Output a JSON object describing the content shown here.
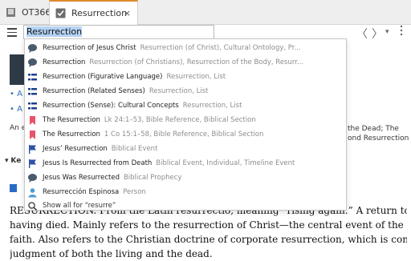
{
  "tabs": [
    {
      "label": "OT366",
      "icon": "book-icon"
    },
    {
      "label": "Resurrection",
      "icon": "checkbox-icon",
      "close": "×"
    }
  ],
  "toolbar": {
    "search_value": "Resurrection",
    "back": "〈",
    "forward": "〉",
    "more": "▾"
  },
  "article": {
    "bullets": [
      "A",
      "A"
    ],
    "summary_left": "An e",
    "summary_right_1": "the Dead; The",
    "summary_right_2": "ond Resurrection",
    "key_label": "Ke",
    "body_lines": [
      "RESURRECTION. From the Latin resurrectio, meaning “rising again.” A return to life after",
      "having died. Mainly refers to the resurrection of Christ—the central event of the Christian",
      "faith. Also refers to the Christian doctrine of corporate resurrection, which is connected to the",
      "judgment of both the living and the dead."
    ]
  },
  "suggestions": [
    {
      "icon": "speech-bubble-icon",
      "text": "Resurrection of Jesus Christ",
      "meta": "Resurrection (of Christ), Cultural Ontology, Pr..."
    },
    {
      "icon": "speech-bubble-icon",
      "text": "Resurrection",
      "meta": "Resurrection (of Christians), Resurrection of the Body, Resurr..."
    },
    {
      "icon": "list-icon",
      "text": "Resurrection (Figurative Language)",
      "meta": "Resurrection, List"
    },
    {
      "icon": "list-icon",
      "text": "Resurrection (Related Senses)",
      "meta": "Resurrection, List"
    },
    {
      "icon": "list-icon",
      "text": "Resurrection (Sense): Cultural Concepts",
      "meta": "Resurrection, List"
    },
    {
      "icon": "bookmark-icon",
      "text": "The Resurrection",
      "meta": "Lk 24:1–53, Bible Reference, Biblical Section"
    },
    {
      "icon": "bookmark-icon",
      "text": "The Resurrection",
      "meta": "1 Co 15:1–58, Bible Reference, Biblical Section"
    },
    {
      "icon": "flag-icon",
      "text": "Jesus’ Resurrection",
      "meta": "Biblical Event"
    },
    {
      "icon": "flag-icon",
      "text": "Jesus Is Resurrected from Death",
      "meta": "Biblical Event, Individual, Timeline Event"
    },
    {
      "icon": "speech-bubble-icon",
      "text": "Jesus Was Resurrected",
      "meta": "Biblical Prophecy"
    },
    {
      "icon": "person-icon",
      "text": "Resurrección Espinosa",
      "meta": "Person"
    },
    {
      "icon": "search-icon",
      "text": "Show all for “resurre”",
      "meta": ""
    }
  ],
  "colors": {
    "accent_tab": "#e0892d",
    "bubble": "#4a5a6e",
    "list": "#1e3e8a",
    "bookmark": "#e8546a",
    "flag": "#2e4fa6",
    "person": "#4d9ad6",
    "meta_text": "#8d8d8d"
  }
}
